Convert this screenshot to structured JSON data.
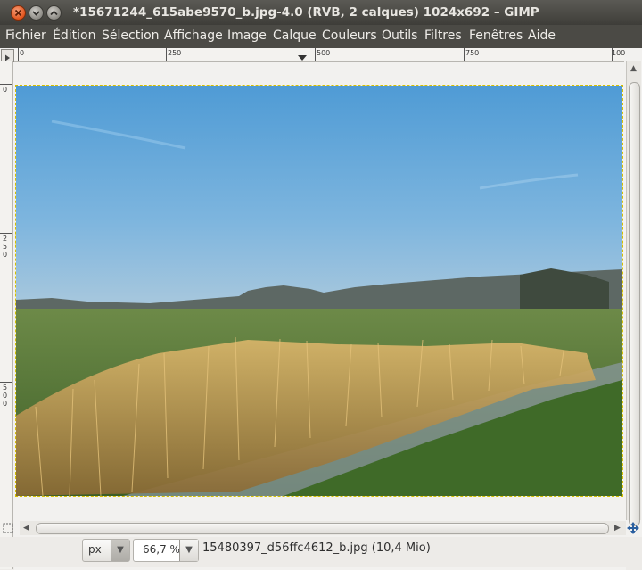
{
  "window": {
    "title": "*15671244_615abe9570_b.jpg-4.0 (RVB, 2 calques) 1024x692 – GIMP"
  },
  "menu": [
    {
      "label": "Fichier",
      "name": "menu-fichier"
    },
    {
      "label": "Édition",
      "name": "menu-edition"
    },
    {
      "label": "Sélection",
      "name": "menu-selection"
    },
    {
      "label": "Affichage",
      "name": "menu-affichage"
    },
    {
      "label": "Image",
      "name": "menu-image"
    },
    {
      "label": "Calque",
      "name": "menu-calque"
    },
    {
      "label": "Couleurs",
      "name": "menu-couleurs"
    },
    {
      "label": "Outils",
      "name": "menu-outils"
    },
    {
      "label": "Filtres",
      "name": "menu-filtres"
    },
    {
      "label": "Fenêtres",
      "name": "menu-fenetres"
    },
    {
      "label": "Aide",
      "name": "menu-aide"
    }
  ],
  "rulers": {
    "horizontal": [
      "0",
      "250",
      "500",
      "750",
      "100"
    ],
    "vertical": [
      "0",
      "250",
      "500"
    ]
  },
  "status": {
    "unit": "px",
    "zoom": "66,7 %",
    "file_info": "15480397_d56ffc4612_b.jpg (10,4 Mio)"
  },
  "colors": {
    "titlebar": "#3e3d39",
    "menubar": "#4b4a45",
    "sky": "#5fa3d6",
    "grass": "#4f7a32",
    "reeds": "#c9a55a"
  },
  "icons": {
    "close": "close-icon",
    "minimize": "minimize-icon",
    "maximize": "maximize-icon",
    "navigate": "navigate-icon",
    "quickmask": "quick-mask-icon"
  }
}
